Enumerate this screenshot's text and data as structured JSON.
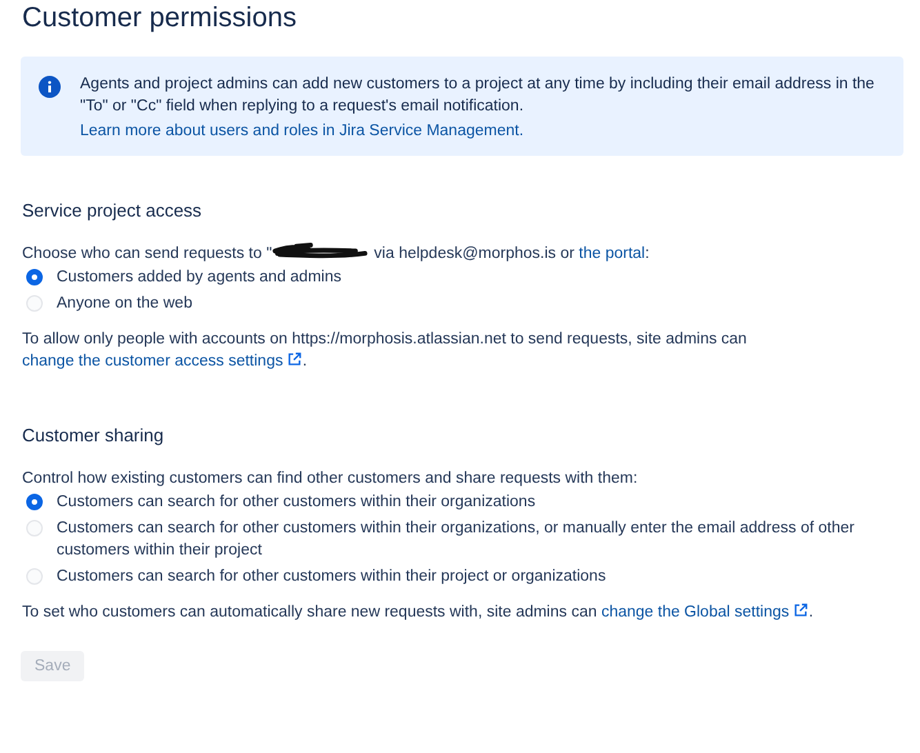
{
  "page": {
    "title": "Customer permissions"
  },
  "info_banner": {
    "text": "Agents and project admins can add new customers to a project at any time by including their email address in the \"To\" or \"Cc\" field when replying to a request's email notification.",
    "link": "Learn more about users and roles in Jira Service Management."
  },
  "sections": [
    {
      "heading": "Service project access",
      "intro": {
        "text": "Choose who can send requests to \"",
        "redacted": true,
        "after": "via helpdesk@morphos.is or ",
        "link": "the portal",
        "end": ":"
      },
      "options": [
        {
          "label": "Customers added by agents and admins",
          "selected": true
        },
        {
          "label": "Anyone on the web",
          "selected": false
        }
      ],
      "note": {
        "text": "To allow only people with accounts on https://morphosis.atlassian.net to send requests, site admins can ",
        "link": "change the customer access settings",
        "end": "."
      }
    },
    {
      "heading": "Customer sharing",
      "intro": {
        "text": "Control how existing customers can find other customers and share requests with them:"
      },
      "options": [
        {
          "label": "Customers can search for other customers within their organizations",
          "selected": true
        },
        {
          "label": "Customers can search for other customers within their organizations, or manually enter the email address of other customers within their project",
          "selected": false
        },
        {
          "label": "Customers can search for other customers within their project or organizations",
          "selected": false
        }
      ],
      "note": {
        "text": "To set who customers can automatically share new requests with, site admins can ",
        "link": "change the Global settings",
        "end": "."
      }
    }
  ],
  "save_button": {
    "label": "Save",
    "disabled": true
  }
}
